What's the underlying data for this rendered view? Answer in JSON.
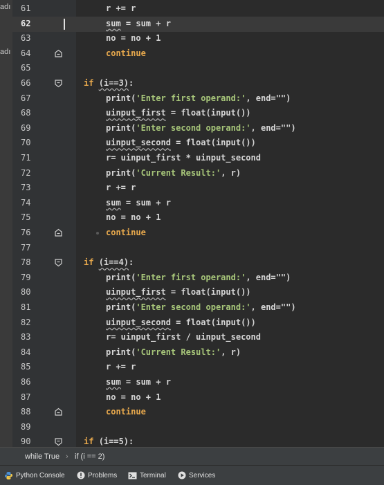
{
  "left_strip": {
    "labels": [
      "adı",
      "adı"
    ]
  },
  "editor": {
    "lines": [
      {
        "n": "61",
        "indent": 5,
        "tokens": [
          {
            "t": "r += r"
          }
        ]
      },
      {
        "n": "62",
        "indent": 5,
        "current": true,
        "caret": true,
        "tokens": [
          {
            "t": "sum",
            "c": "id"
          },
          {
            "t": " = sum + r"
          }
        ]
      },
      {
        "n": "63",
        "indent": 5,
        "tokens": [
          {
            "t": "no = no + 1"
          }
        ]
      },
      {
        "n": "64",
        "indent": 5,
        "fold": "end",
        "tokens": [
          {
            "t": "continue",
            "c": "kw"
          }
        ]
      },
      {
        "n": "65",
        "indent": 0,
        "tokens": []
      },
      {
        "n": "66",
        "indent": 1,
        "fold": "start",
        "tokens": [
          {
            "t": "if ",
            "c": "kw"
          },
          {
            "t": "(i==3)",
            "c": "id"
          },
          {
            "t": ":"
          }
        ]
      },
      {
        "n": "67",
        "indent": 5,
        "tokens": [
          {
            "t": "print('Enter first operand:', end=\"\")"
          }
        ]
      },
      {
        "n": "68",
        "indent": 5,
        "tokens": [
          {
            "t": "uinput_first",
            "c": "id"
          },
          {
            "t": " = float(input())"
          }
        ]
      },
      {
        "n": "69",
        "indent": 5,
        "tokens": [
          {
            "t": "print('Enter second operand:', end=\"\")"
          }
        ]
      },
      {
        "n": "70",
        "indent": 5,
        "tokens": [
          {
            "t": "uinput_second",
            "c": "id"
          },
          {
            "t": " = float(input())"
          }
        ]
      },
      {
        "n": "71",
        "indent": 5,
        "tokens": [
          {
            "t": "r= uinput_first * uinput_second"
          }
        ]
      },
      {
        "n": "72",
        "indent": 5,
        "tokens": [
          {
            "t": "print('Current Result:', r)"
          }
        ]
      },
      {
        "n": "73",
        "indent": 5,
        "tokens": [
          {
            "t": "r += r"
          }
        ]
      },
      {
        "n": "74",
        "indent": 5,
        "tokens": [
          {
            "t": "sum",
            "c": "id"
          },
          {
            "t": " = sum + r"
          }
        ]
      },
      {
        "n": "75",
        "indent": 5,
        "tokens": [
          {
            "t": "no = no + 1"
          }
        ]
      },
      {
        "n": "76",
        "indent": 5,
        "fold": "end",
        "bp": true,
        "tokens": [
          {
            "t": "continue",
            "c": "kw"
          }
        ]
      },
      {
        "n": "77",
        "indent": 0,
        "tokens": []
      },
      {
        "n": "78",
        "indent": 1,
        "fold": "start",
        "tokens": [
          {
            "t": "if ",
            "c": "kw"
          },
          {
            "t": "(i==4)",
            "c": "id"
          },
          {
            "t": ":"
          }
        ]
      },
      {
        "n": "79",
        "indent": 5,
        "tokens": [
          {
            "t": "print('Enter first operand:', end=\"\")"
          }
        ]
      },
      {
        "n": "80",
        "indent": 5,
        "tokens": [
          {
            "t": "uinput_first",
            "c": "id"
          },
          {
            "t": " = float(input())"
          }
        ]
      },
      {
        "n": "81",
        "indent": 5,
        "tokens": [
          {
            "t": "print('Enter second operand:', end=\"\")"
          }
        ]
      },
      {
        "n": "82",
        "indent": 5,
        "tokens": [
          {
            "t": "uinput_second",
            "c": "id"
          },
          {
            "t": " = float(input())"
          }
        ]
      },
      {
        "n": "83",
        "indent": 5,
        "tokens": [
          {
            "t": "r= uinput_first / uinput_second"
          }
        ]
      },
      {
        "n": "84",
        "indent": 5,
        "tokens": [
          {
            "t": "print('Current Result:', r)"
          }
        ]
      },
      {
        "n": "85",
        "indent": 5,
        "tokens": [
          {
            "t": "r += r"
          }
        ]
      },
      {
        "n": "86",
        "indent": 5,
        "tokens": [
          {
            "t": "sum",
            "c": "id"
          },
          {
            "t": " = sum + r"
          }
        ]
      },
      {
        "n": "87",
        "indent": 5,
        "tokens": [
          {
            "t": "no = no + 1"
          }
        ]
      },
      {
        "n": "88",
        "indent": 5,
        "fold": "end",
        "tokens": [
          {
            "t": "continue",
            "c": "kw"
          }
        ]
      },
      {
        "n": "89",
        "indent": 0,
        "tokens": []
      },
      {
        "n": "90",
        "indent": 1,
        "fold": "start",
        "tokens": [
          {
            "t": "if ",
            "c": "kw"
          },
          {
            "t": "(i==5)",
            "c": "id"
          },
          {
            "t": ":"
          }
        ]
      }
    ]
  },
  "breadcrumb": {
    "item1": "while True",
    "separator": "›",
    "item2": "if (i == 2)"
  },
  "toolbar": {
    "python_console": "Python Console",
    "problems": "Problems",
    "terminal": "Terminal",
    "services": "Services"
  },
  "colors": {
    "keyword": "#e8a94d",
    "string": "#a8c77a",
    "text": "#d6d6d6",
    "background": "#2b2b2b"
  }
}
